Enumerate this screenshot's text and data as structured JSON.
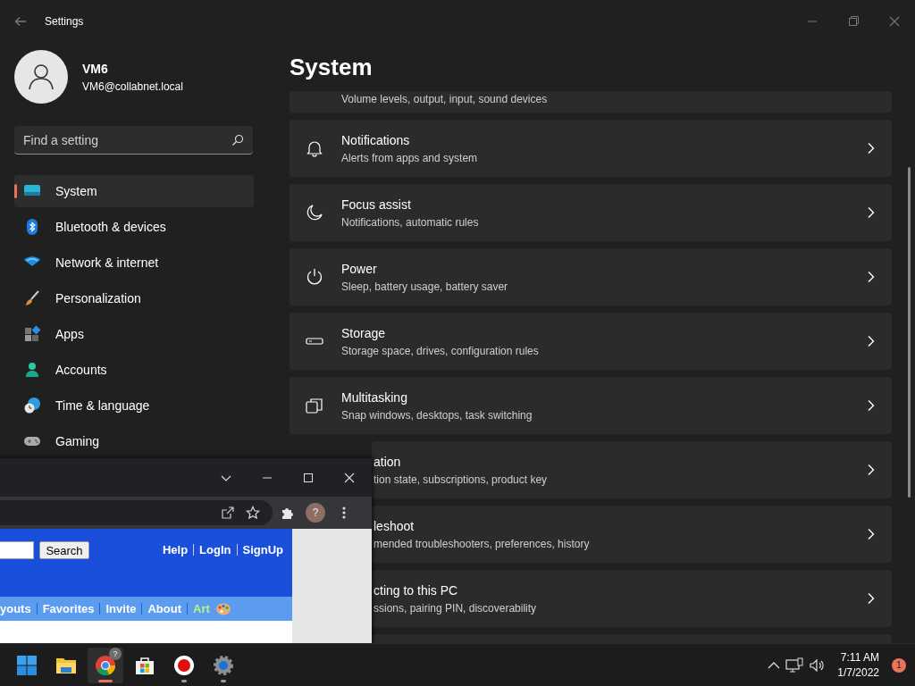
{
  "window": {
    "title": "Settings"
  },
  "user": {
    "name": "VM6",
    "email": "VM6@collabnet.local"
  },
  "search": {
    "placeholder": "Find a setting"
  },
  "nav": [
    {
      "label": "System",
      "selected": true
    },
    {
      "label": "Bluetooth & devices",
      "selected": false
    },
    {
      "label": "Network & internet",
      "selected": false
    },
    {
      "label": "Personalization",
      "selected": false
    },
    {
      "label": "Apps",
      "selected": false
    },
    {
      "label": "Accounts",
      "selected": false
    },
    {
      "label": "Time & language",
      "selected": false
    },
    {
      "label": "Gaming",
      "selected": false
    }
  ],
  "page_title": "System",
  "cards": [
    {
      "kind": "top",
      "subtitle": "Volume levels, output, input, sound devices"
    },
    {
      "kind": "full",
      "title": "Notifications",
      "subtitle": "Alerts from apps and system"
    },
    {
      "kind": "full",
      "title": "Focus assist",
      "subtitle": "Notifications, automatic rules"
    },
    {
      "kind": "full",
      "title": "Power",
      "subtitle": "Sleep, battery usage, battery saver"
    },
    {
      "kind": "full",
      "title": "Storage",
      "subtitle": "Storage space, drives, configuration rules"
    },
    {
      "kind": "full",
      "title": "Multitasking",
      "subtitle": "Snap windows, desktops, task switching"
    },
    {
      "kind": "covered",
      "title": "ation",
      "subtitle": "tion state, subscriptions, product key"
    },
    {
      "kind": "covered",
      "title": "leshoot",
      "subtitle": "mended troubleshooters, preferences, history"
    },
    {
      "kind": "covered",
      "title": "cting to this PC",
      "subtitle": "ssions, pairing PIN, discoverability"
    },
    {
      "kind": "edge"
    }
  ],
  "browser": {
    "avatar": "?",
    "search_button": "Search",
    "top_links": [
      "Help",
      "LogIn",
      "SignUp"
    ],
    "nav_links": [
      {
        "label": "youts",
        "kind": "plain"
      },
      {
        "label": "Favorites",
        "kind": "plain"
      },
      {
        "label": "Invite",
        "kind": "plain"
      },
      {
        "label": "About",
        "kind": "plain"
      },
      {
        "label": "Art",
        "kind": "art"
      }
    ]
  },
  "taskbar": {
    "apps": [
      {
        "selected": false,
        "running": false
      },
      {
        "selected": false,
        "running": false
      },
      {
        "selected": true,
        "running": true,
        "badge": "?"
      },
      {
        "selected": false,
        "running": false
      },
      {
        "selected": false,
        "running": true
      },
      {
        "selected": false,
        "running": true
      }
    ],
    "time": "7:11 AM",
    "date": "1/7/2022",
    "notification_count": "1"
  }
}
